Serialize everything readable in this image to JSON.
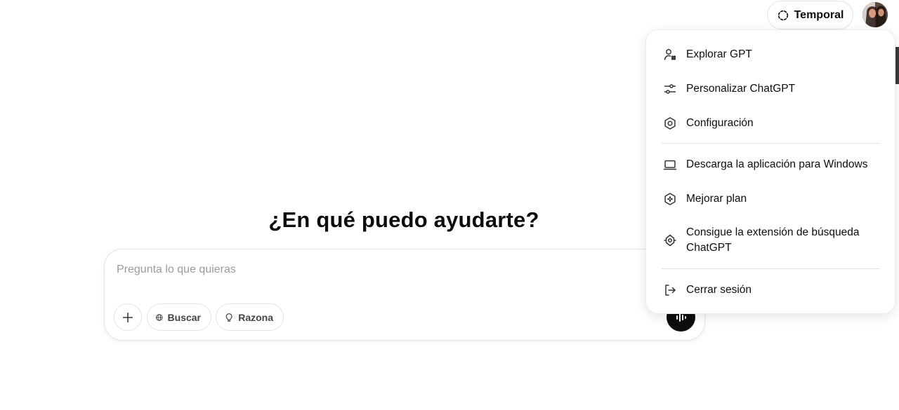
{
  "header": {
    "temporal_label": "Temporal"
  },
  "main": {
    "headline": "¿En qué puedo ayudarte?"
  },
  "composer": {
    "placeholder": "Pregunta lo que quieras",
    "buscar_label": "Buscar",
    "razona_label": "Razona"
  },
  "menu": {
    "items": [
      {
        "label": "Explorar GPT",
        "icon": "explore-gpts-icon"
      },
      {
        "label": "Personalizar ChatGPT",
        "icon": "sliders-icon"
      },
      {
        "label": "Configuración",
        "icon": "gear-icon"
      },
      {
        "label": "Descarga la aplicación para Windows",
        "icon": "laptop-icon"
      },
      {
        "label": "Mejorar plan",
        "icon": "upgrade-icon"
      },
      {
        "label": "Consigue la extensión de búsqueda ChatGPT",
        "icon": "extension-icon"
      },
      {
        "label": "Cerrar sesión",
        "icon": "logout-icon"
      }
    ]
  },
  "colors": {
    "accent_badge": "#e8f000",
    "voice_button": "#0d0d0d"
  }
}
